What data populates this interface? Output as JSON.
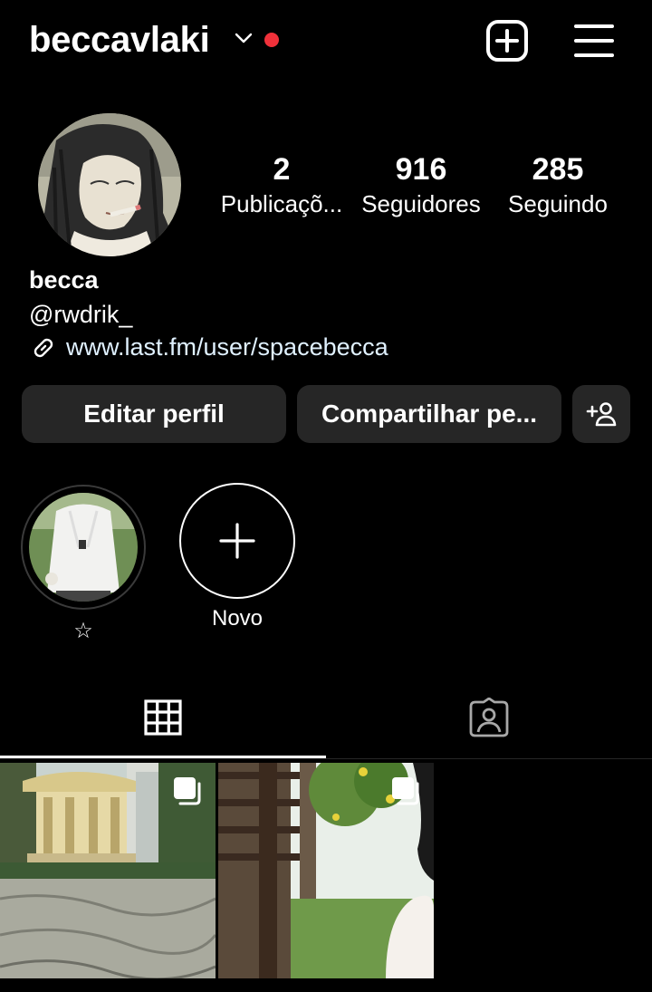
{
  "header": {
    "username": "beccavlaki",
    "icons": {
      "dropdown": "chevron-down-icon",
      "notification": "red-dot",
      "create": "plus-square-icon",
      "menu": "hamburger-menu-icon"
    }
  },
  "profile": {
    "stats": [
      {
        "value": "2",
        "label": "Publicaçõ..."
      },
      {
        "value": "916",
        "label": "Seguidores"
      },
      {
        "value": "285",
        "label": "Seguindo"
      }
    ],
    "name": "becca",
    "handle": "@rwdrik_",
    "link": "www.last.fm/user/spacebecca"
  },
  "actions": {
    "edit_label": "Editar perfil",
    "share_label": "Compartilhar pe...",
    "add_icon": "add-person-icon"
  },
  "highlights": {
    "items": [
      {
        "label": "☆"
      }
    ],
    "new_label": "Novo"
  },
  "tabs": [
    {
      "icon": "grid-icon",
      "active": true
    },
    {
      "icon": "tagged-person-icon",
      "active": false
    }
  ],
  "colors": {
    "background": "#000000",
    "button_bg": "#262626",
    "notification_dot": "#f0313a",
    "link_text": "#e0f1ff"
  }
}
